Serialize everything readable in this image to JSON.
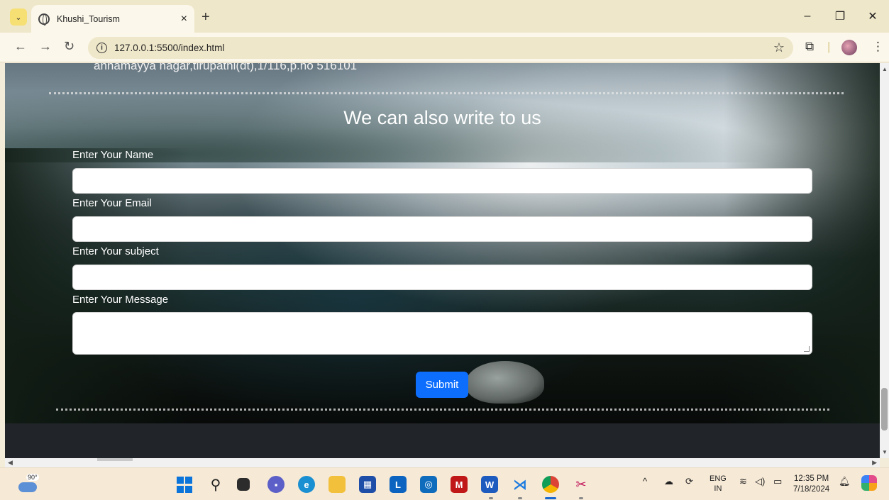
{
  "browser": {
    "tab_title": "Khushi_Tourism",
    "tab_close": "×",
    "new_tab": "+",
    "url": "127.0.0.1:5500/index.html",
    "window_controls": {
      "minimize": "–",
      "restore": "❐",
      "close": "✕"
    }
  },
  "page": {
    "address_line": "annamayya nagar,tirupathi(dt),1/116,p.no 516101",
    "contact": {
      "title": "We can also write to us",
      "fields": [
        {
          "label": "Enter Your Name",
          "value": ""
        },
        {
          "label": "Enter Your Email",
          "value": ""
        },
        {
          "label": "Enter Your subject",
          "value": ""
        },
        {
          "label": "Enter Your Message",
          "value": ""
        }
      ],
      "submit_label": "Submit"
    }
  },
  "taskbar": {
    "weather_temp": "90°",
    "icons": [
      "windows-start",
      "search",
      "task-view",
      "teams-chat",
      "edge",
      "file-explorer",
      "microsoft-store",
      "lync",
      "outlook",
      "mcafee",
      "word",
      "vscode",
      "chrome",
      "snipping-tool"
    ],
    "language": "ENG",
    "region": "IN",
    "time": "12:35 PM",
    "date": "7/18/2024"
  }
}
